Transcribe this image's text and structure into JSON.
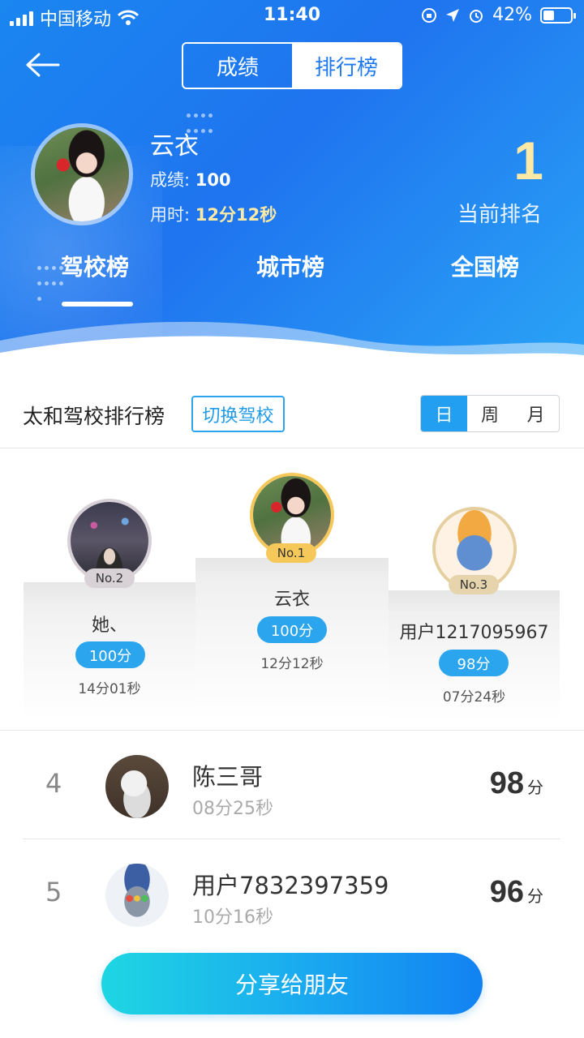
{
  "status_bar": {
    "carrier": "中国移动",
    "time": "11:40",
    "battery": "42%",
    "battery_level": 0.42
  },
  "nav": {
    "segments": [
      "成绩",
      "排行榜"
    ],
    "active_segment": 1
  },
  "profile": {
    "name": "云衣",
    "score_label": "成绩:",
    "score": "100",
    "time_label": "用时:",
    "time": "12分12秒",
    "rank": "1",
    "rank_label": "当前排名"
  },
  "tabs": [
    "驾校榜",
    "城市榜",
    "全国榜"
  ],
  "school": {
    "title": "太和驾校排行榜",
    "switch_label": "切换驾校",
    "periods": [
      "日",
      "周",
      "月"
    ],
    "active_period": 0
  },
  "podium": [
    {
      "badge": "No.1",
      "name": "云衣",
      "score": "100分",
      "time": "12分12秒"
    },
    {
      "badge": "No.2",
      "name": "她、",
      "score": "100分",
      "time": "14分01秒"
    },
    {
      "badge": "No.3",
      "name": "用户1217095967",
      "score": "98分",
      "time": "07分24秒"
    }
  ],
  "list": [
    {
      "rank": "4",
      "name": "陈三哥",
      "time": "08分25秒",
      "score": "98",
      "unit": "分"
    },
    {
      "rank": "5",
      "name": "用户7832397359",
      "time": "10分16秒",
      "score": "96",
      "unit": "分"
    }
  ],
  "share_label": "分享给朋友",
  "colors": {
    "primary": "#1f7af0",
    "accent": "#229ff1",
    "gold": "#fde9a6"
  }
}
